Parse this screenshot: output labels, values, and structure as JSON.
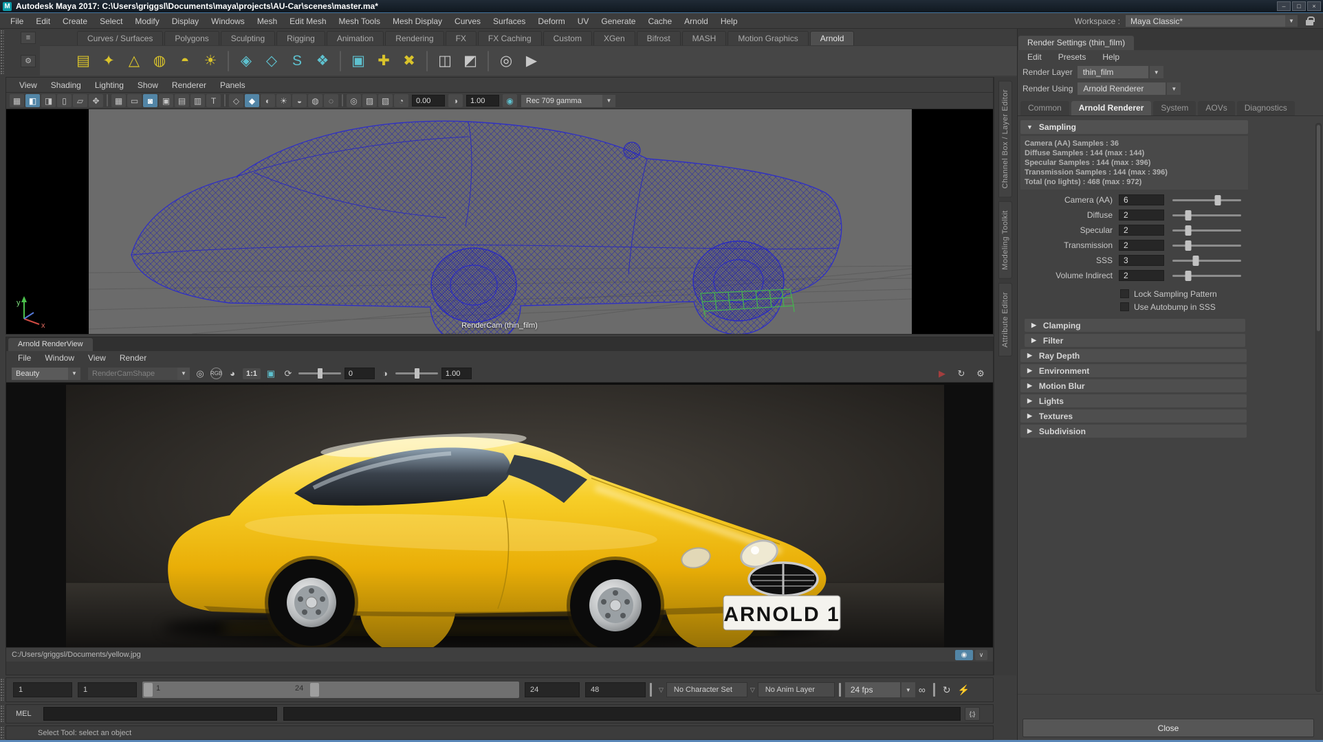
{
  "window": {
    "title": "Autodesk Maya 2017: C:\\Users\\griggsl\\Documents\\maya\\projects\\AU-Car\\scenes\\master.ma*",
    "minimize": "–",
    "maximize": "□",
    "close": "×"
  },
  "menu_bar": {
    "items": [
      "File",
      "Edit",
      "Create",
      "Select",
      "Modify",
      "Display",
      "Windows",
      "Mesh",
      "Edit Mesh",
      "Mesh Tools",
      "Mesh Display",
      "Curves",
      "Surfaces",
      "Deform",
      "UV",
      "Generate",
      "Cache",
      "Arnold",
      "Help"
    ],
    "workspace_label": "Workspace :",
    "workspace_value": "Maya Classic*"
  },
  "shelf": {
    "tabs": [
      {
        "label": "Curves / Surfaces"
      },
      {
        "label": "Polygons"
      },
      {
        "label": "Sculpting"
      },
      {
        "label": "Rigging"
      },
      {
        "label": "Animation"
      },
      {
        "label": "Rendering"
      },
      {
        "label": "FX"
      },
      {
        "label": "FX Caching"
      },
      {
        "label": "Custom"
      },
      {
        "label": "XGen"
      },
      {
        "label": "Bifrost"
      },
      {
        "label": "MASH"
      },
      {
        "label": "Motion Graphics"
      },
      {
        "label": "Arnold",
        "active": true
      }
    ],
    "icons": [
      {
        "name": "area-light-icon",
        "glyph": "▤",
        "color": "#d9c32b"
      },
      {
        "name": "point-light-icon",
        "glyph": "✦",
        "color": "#d9c32b"
      },
      {
        "name": "spot-light-icon",
        "glyph": "△",
        "color": "#d9c32b"
      },
      {
        "name": "skydome-light-icon",
        "glyph": "◍",
        "color": "#d9c32b"
      },
      {
        "name": "mesh-light-icon",
        "glyph": "◓",
        "color": "#d9c32b"
      },
      {
        "name": "physical-sky-icon",
        "glyph": "☀",
        "color": "#d9c32b"
      },
      {
        "name": "separator"
      },
      {
        "name": "standin-create-icon",
        "glyph": "◈",
        "color": "#5ec1cf"
      },
      {
        "name": "standin-icon",
        "glyph": "◇",
        "color": "#5ec1cf"
      },
      {
        "name": "curve-collector-icon",
        "glyph": "S",
        "color": "#5ec1cf"
      },
      {
        "name": "volume-icon",
        "glyph": "❖",
        "color": "#5ec1cf"
      },
      {
        "name": "separator"
      },
      {
        "name": "render-region-icon",
        "glyph": "▣",
        "color": "#5ec1cf"
      },
      {
        "name": "bake-geometry-icon",
        "glyph": "✚",
        "color": "#d9c32b"
      },
      {
        "name": "flush-cache-icon",
        "glyph": "✖",
        "color": "#d9c32b"
      },
      {
        "name": "separator"
      },
      {
        "name": "tx-manager-icon",
        "glyph": "◫",
        "color": "#c8c8c8"
      },
      {
        "name": "light-manager-icon",
        "glyph": "◩",
        "color": "#c8c8c8"
      },
      {
        "name": "separator"
      },
      {
        "name": "arnold-renderview-icon",
        "glyph": "◎",
        "color": "#c8c8c8"
      },
      {
        "name": "render-sequence-icon",
        "glyph": "▶",
        "color": "#c8c8c8"
      }
    ]
  },
  "viewport": {
    "menus": [
      "View",
      "Shading",
      "Lighting",
      "Show",
      "Renderer",
      "Panels"
    ],
    "toolbar_icons": [
      {
        "name": "select-camera-icon",
        "glyph": "▦"
      },
      {
        "name": "lock-camera-icon",
        "glyph": "◧",
        "hl": true
      },
      {
        "name": "camera-attributes-icon",
        "glyph": "◨"
      },
      {
        "name": "bookmark-icon",
        "glyph": "▯"
      },
      {
        "name": "image-plane-icon",
        "glyph": "▱"
      },
      {
        "name": "pan-zoom-icon",
        "glyph": "✥"
      },
      {
        "name": "separator"
      },
      {
        "name": "grid-icon",
        "glyph": "▦"
      },
      {
        "name": "film-gate-icon",
        "glyph": "▭"
      },
      {
        "name": "resolution-gate-icon",
        "glyph": "◙",
        "hl": true
      },
      {
        "name": "gate-mask-icon",
        "glyph": "▣"
      },
      {
        "name": "field-chart-icon",
        "glyph": "▤"
      },
      {
        "name": "safe-action-icon",
        "glyph": "▥"
      },
      {
        "name": "safe-title-icon",
        "glyph": "T"
      },
      {
        "name": "separator"
      },
      {
        "name": "wireframe-icon",
        "glyph": "◇"
      },
      {
        "name": "shaded-icon",
        "glyph": "◆",
        "hl": true
      },
      {
        "name": "textured-icon",
        "glyph": "◐"
      },
      {
        "name": "lights-icon",
        "glyph": "☀"
      },
      {
        "name": "shadows-icon",
        "glyph": "◒"
      },
      {
        "name": "ambient-occlusion-icon",
        "glyph": "◍"
      },
      {
        "name": "motion-blur-icon",
        "glyph": "◌"
      },
      {
        "name": "separator"
      },
      {
        "name": "isolate-select-icon",
        "glyph": "◎"
      },
      {
        "name": "xray-icon",
        "glyph": "▨"
      },
      {
        "name": "plugin-shapes-icon",
        "glyph": "▧"
      }
    ],
    "exposure_value": "0.00",
    "gamma_value": "1.00",
    "colorspace": "Rec 709 gamma",
    "camera_label": "RenderCam (thin_film)",
    "axis_x": "x",
    "axis_y": "y"
  },
  "side_tabs": [
    "Channel Box / Layer Editor",
    "Modeling Toolkit",
    "Attribute Editor"
  ],
  "render_view": {
    "tab": "Arnold RenderView",
    "menus": [
      "File",
      "Window",
      "View",
      "Render"
    ],
    "aov_value": "Beauty",
    "camera_value": "RenderCamShape",
    "zoom_value": "1:1",
    "exposure_value": "0",
    "gamma_value": "1.00",
    "status_path": "C:/Users/griggsl/Documents/yellow.jpg",
    "license_plate": "ARNOLD 1"
  },
  "render_settings": {
    "title": "Render Settings (thin_film)",
    "menus": [
      "Edit",
      "Presets",
      "Help"
    ],
    "render_layer_label": "Render Layer",
    "render_layer_value": "thin_film",
    "render_using_label": "Render Using",
    "render_using_value": "Arnold Renderer",
    "tabs": [
      {
        "label": "Common"
      },
      {
        "label": "Arnold Renderer",
        "active": true
      },
      {
        "label": "System"
      },
      {
        "label": "AOVs"
      },
      {
        "label": "Diagnostics"
      }
    ],
    "sampling_header": "Sampling",
    "sampling_info": [
      "Camera (AA) Samples : 36",
      "Diffuse Samples : 144 (max : 144)",
      "Specular Samples : 144 (max : 396)",
      "Transmission Samples : 144 (max : 396)",
      "Total (no lights) : 468 (max : 972)"
    ],
    "sliders": [
      {
        "label": "Camera (AA)",
        "value": "6",
        "pos": 66
      },
      {
        "label": "Diffuse",
        "value": "2",
        "pos": 23
      },
      {
        "label": "Specular",
        "value": "2",
        "pos": 23
      },
      {
        "label": "Transmission",
        "value": "2",
        "pos": 23
      },
      {
        "label": "SSS",
        "value": "3",
        "pos": 34
      },
      {
        "label": "Volume Indirect",
        "value": "2",
        "pos": 23
      }
    ],
    "checkboxes": [
      {
        "label": "Lock Sampling Pattern"
      },
      {
        "label": "Use Autobump in SSS"
      }
    ],
    "sections": [
      {
        "label": "Clamping",
        "indent": true
      },
      {
        "label": "Filter",
        "indent": true
      },
      {
        "label": "Ray Depth"
      },
      {
        "label": "Environment"
      },
      {
        "label": "Motion Blur"
      },
      {
        "label": "Lights"
      },
      {
        "label": "Textures"
      },
      {
        "label": "Subdivision"
      }
    ],
    "close_label": "Close"
  },
  "timeline": {
    "current_frame": "1",
    "playback_start": "1",
    "range_start": "1",
    "range_end": "24",
    "playback_end": "24",
    "animation_end": "48",
    "character_set": "No Character Set",
    "anim_layer": "No Anim Layer",
    "fps": "24 fps"
  },
  "command_line": {
    "label": "MEL"
  },
  "help_line": {
    "text": "Select Tool: select an object"
  }
}
